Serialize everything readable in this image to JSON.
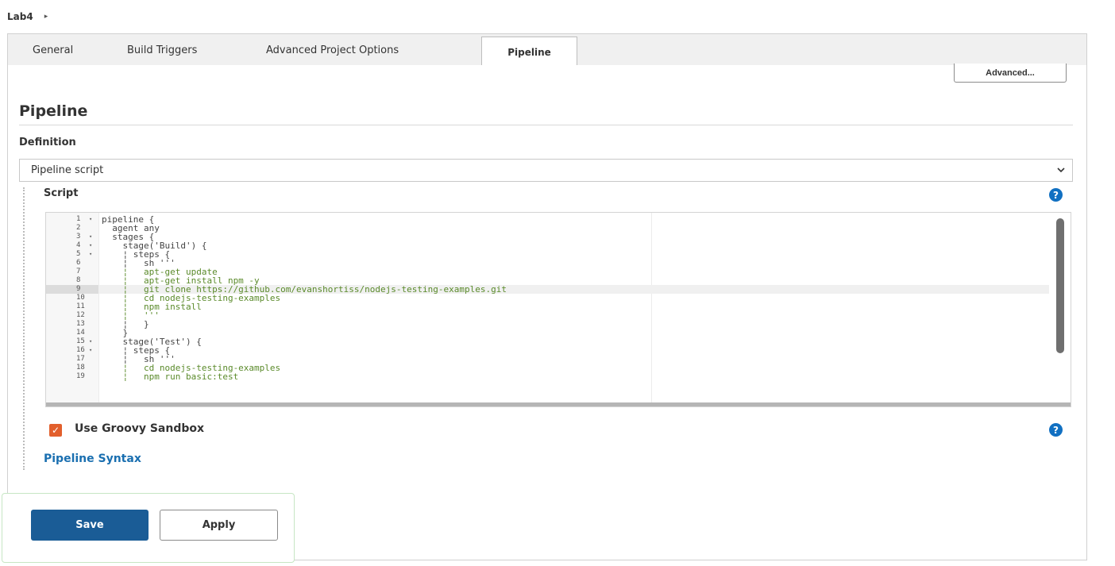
{
  "breadcrumb": {
    "project": "Lab4",
    "arrow": "▸"
  },
  "tabs": [
    {
      "label": "General",
      "active": false
    },
    {
      "label": "Build Triggers",
      "active": false
    },
    {
      "label": "Advanced Project Options",
      "active": false
    },
    {
      "label": "Pipeline",
      "active": true
    }
  ],
  "advanced_button": "Advanced...",
  "section": {
    "title": "Pipeline",
    "definition_label": "Definition",
    "definition_value": "Pipeline script",
    "script_label": "Script",
    "help_glyph": "?"
  },
  "editor": {
    "active_line": 9,
    "lines": [
      {
        "n": "1",
        "fold": true,
        "text": "pipeline {",
        "str": false
      },
      {
        "n": "2",
        "fold": false,
        "text": "  agent any",
        "str": false
      },
      {
        "n": "3",
        "fold": true,
        "text": "  stages {",
        "str": false
      },
      {
        "n": "4",
        "fold": true,
        "text": "    stage('Build') {",
        "str": false
      },
      {
        "n": "5",
        "fold": true,
        "text": "    ¦ steps {",
        "str": false
      },
      {
        "n": "6",
        "fold": false,
        "text": "    ¦   sh '''",
        "str": false
      },
      {
        "n": "7",
        "fold": false,
        "text": "    ¦   apt-get update",
        "str": true
      },
      {
        "n": "8",
        "fold": false,
        "text": "    ¦   apt-get install npm -y",
        "str": true
      },
      {
        "n": "9",
        "fold": false,
        "text": "    ¦   git clone https://github.com/evanshortiss/nodejs-testing-examples.git",
        "str": true
      },
      {
        "n": "10",
        "fold": false,
        "text": "    ¦   cd nodejs-testing-examples",
        "str": true
      },
      {
        "n": "11",
        "fold": false,
        "text": "    ¦   npm install",
        "str": true
      },
      {
        "n": "12",
        "fold": false,
        "text": "    ¦   '''",
        "str": true
      },
      {
        "n": "13",
        "fold": false,
        "text": "    ¦   }",
        "str": false
      },
      {
        "n": "14",
        "fold": false,
        "text": "    }",
        "str": false
      },
      {
        "n": "15",
        "fold": true,
        "text": "    stage('Test') {",
        "str": false
      },
      {
        "n": "16",
        "fold": true,
        "text": "    ¦ steps {",
        "str": false
      },
      {
        "n": "17",
        "fold": false,
        "text": "    ¦   sh '''",
        "str": false
      },
      {
        "n": "18",
        "fold": false,
        "text": "    ¦   cd nodejs-testing-examples",
        "str": true
      },
      {
        "n": "19",
        "fold": false,
        "text": "    ¦   npm run basic:test",
        "str": true
      }
    ]
  },
  "sandbox": {
    "label": "Use Groovy Sandbox",
    "checked": true,
    "check_glyph": "✓"
  },
  "pipeline_syntax_link": "Pipeline Syntax",
  "buttons": {
    "save": "Save",
    "apply": "Apply"
  },
  "colors": {
    "accent": "#1a5c96",
    "link": "#1a6fb0",
    "checkbox": "#e25f2c",
    "help": "#1170c2"
  },
  "icons": {
    "dropdown": "chevron-down-icon",
    "help": "help-circle-icon",
    "breadcrumb": "triangle-right-icon"
  }
}
